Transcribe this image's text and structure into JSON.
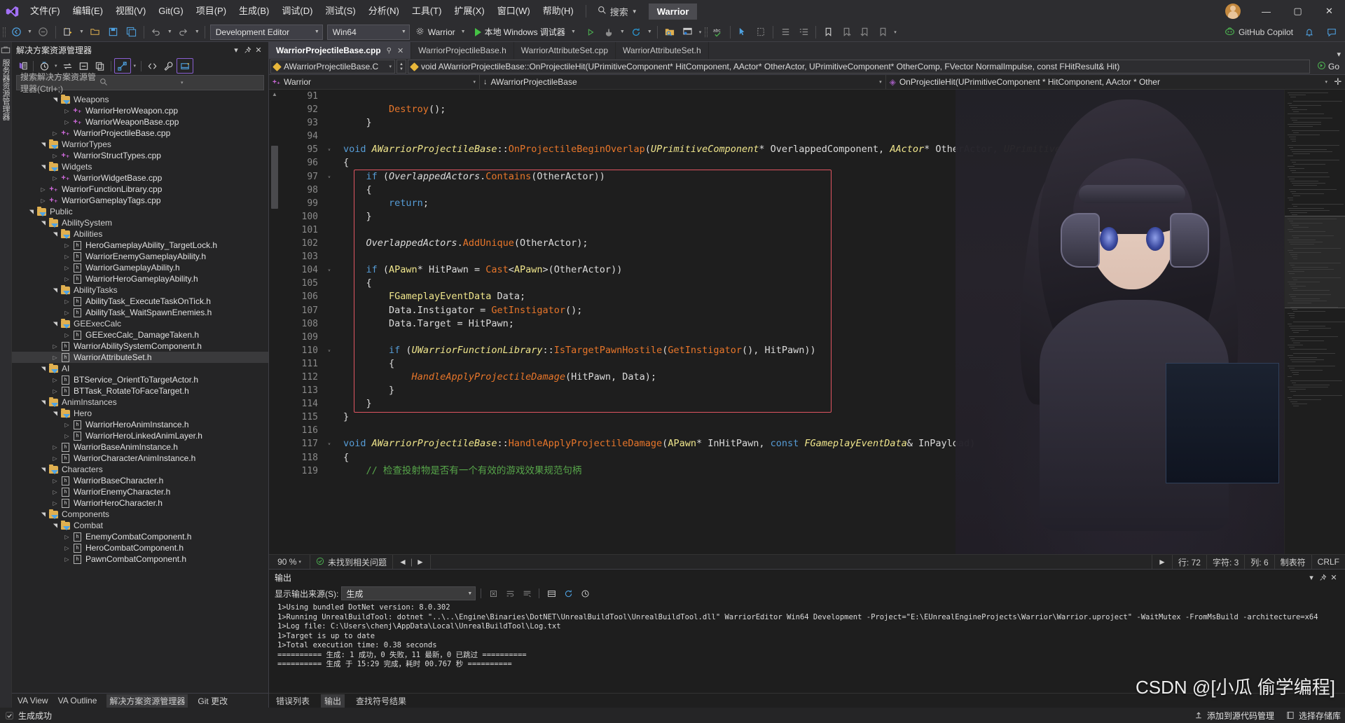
{
  "app": {
    "window_title": "Warrior",
    "logo_icon": "visual-studio-icon"
  },
  "menu": {
    "items": [
      {
        "label": "文件(F)"
      },
      {
        "label": "编辑(E)"
      },
      {
        "label": "视图(V)"
      },
      {
        "label": "Git(G)"
      },
      {
        "label": "项目(P)"
      },
      {
        "label": "生成(B)"
      },
      {
        "label": "调试(D)"
      },
      {
        "label": "测试(S)"
      },
      {
        "label": "分析(N)"
      },
      {
        "label": "工具(T)"
      },
      {
        "label": "扩展(X)"
      },
      {
        "label": "窗口(W)"
      },
      {
        "label": "帮助(H)"
      }
    ],
    "search_label": "搜索",
    "search_icon": "magnifier-icon"
  },
  "window_controls": {
    "minimize": "—",
    "maximize": "▢",
    "close": "✕",
    "avatar_icon": "user-avatar"
  },
  "toolbar": {
    "back_icon": "navigate-backward-icon",
    "forward_icon": "navigate-forward-icon",
    "new_project_icon": "new-project-icon",
    "open_icon": "open-folder-icon",
    "save_icon": "save-icon",
    "save_all_icon": "save-all-icon",
    "undo_icon": "undo-icon",
    "redo_icon": "redo-icon",
    "config_value": "Development Editor",
    "platform_value": "Win64",
    "startup_project": "Warrior",
    "startup_project_icon": "gear-icon",
    "run_label": "本地 Windows 调试器",
    "run_icon": "play-icon",
    "attach_icon": "play-hollow-icon",
    "hot_reload_icon": "hot-reload-icon",
    "refresh_icon": "refresh-icon",
    "solution_explorer_icon": "folder-search-icon",
    "window_layout_icon": "window-layout-icon",
    "spell_check_icon": "abc-check-icon",
    "pointer_icon": "pointer-icon",
    "comment_icon": "comment-icon",
    "bookmark_icon": "bookmark-icon",
    "list_icon": "list-icon",
    "copilot_label": "GitHub Copilot",
    "copilot_icon": "copilot-icon",
    "notify_icon": "bell-icon",
    "feedback_icon": "feedback-icon"
  },
  "left_rail": {
    "toolbox_icon": "toolbox-icon",
    "label": "服务器资源管理器"
  },
  "solution_explorer": {
    "title": "解决方案资源管理器",
    "dropdown_icon": "chevron-down-icon",
    "pin_icon": "pin-icon",
    "close_icon": "close-icon",
    "toolbar_icons": [
      "solution-icon",
      "pending-changes-icon",
      "sync-icon",
      "collapse-all-icon",
      "copy-icon",
      "show-all-files-icon",
      "code-view-icon",
      "properties-icon",
      "preview-icon"
    ],
    "search_placeholder": "搜索解决方案资源管理器(Ctrl+;)",
    "search_icon": "magnifier-icon",
    "tree": [
      {
        "depth": 3,
        "label": "Weapons",
        "kind": "folder",
        "state": "open"
      },
      {
        "depth": 4,
        "label": "WarriorHeroWeapon.cpp",
        "kind": "cpp",
        "state": "closed"
      },
      {
        "depth": 4,
        "label": "WarriorWeaponBase.cpp",
        "kind": "cpp",
        "state": "closed"
      },
      {
        "depth": 3,
        "label": "WarriorProjectileBase.cpp",
        "kind": "cpp",
        "state": "closed"
      },
      {
        "depth": 2,
        "label": "WarriorTypes",
        "kind": "folder",
        "state": "open"
      },
      {
        "depth": 3,
        "label": "WarriorStructTypes.cpp",
        "kind": "cpp",
        "state": "closed"
      },
      {
        "depth": 2,
        "label": "Widgets",
        "kind": "folder",
        "state": "open"
      },
      {
        "depth": 3,
        "label": "WarriorWidgetBase.cpp",
        "kind": "cpp",
        "state": "closed"
      },
      {
        "depth": 2,
        "label": "WarriorFunctionLibrary.cpp",
        "kind": "cpp",
        "state": "closed"
      },
      {
        "depth": 2,
        "label": "WarriorGameplayTags.cpp",
        "kind": "cpp",
        "state": "closed"
      },
      {
        "depth": 1,
        "label": "Public",
        "kind": "folder",
        "state": "open"
      },
      {
        "depth": 2,
        "label": "AbilitySystem",
        "kind": "folder",
        "state": "open"
      },
      {
        "depth": 3,
        "label": "Abilities",
        "kind": "folder",
        "state": "open"
      },
      {
        "depth": 4,
        "label": "HeroGameplayAbility_TargetLock.h",
        "kind": "h",
        "state": "closed"
      },
      {
        "depth": 4,
        "label": "WarriorEnemyGameplayAbility.h",
        "kind": "h",
        "state": "closed"
      },
      {
        "depth": 4,
        "label": "WarriorGameplayAbility.h",
        "kind": "h",
        "state": "closed"
      },
      {
        "depth": 4,
        "label": "WarriorHeroGameplayAbility.h",
        "kind": "h",
        "state": "closed"
      },
      {
        "depth": 3,
        "label": "AbilityTasks",
        "kind": "folder",
        "state": "open"
      },
      {
        "depth": 4,
        "label": "AbilityTask_ExecuteTaskOnTick.h",
        "kind": "h",
        "state": "closed"
      },
      {
        "depth": 4,
        "label": "AbilityTask_WaitSpawnEnemies.h",
        "kind": "h",
        "state": "closed"
      },
      {
        "depth": 3,
        "label": "GEExecCalc",
        "kind": "folder",
        "state": "open"
      },
      {
        "depth": 4,
        "label": "GEExecCalc_DamageTaken.h",
        "kind": "h",
        "state": "closed"
      },
      {
        "depth": 3,
        "label": "WarriorAbilitySystemComponent.h",
        "kind": "h",
        "state": "closed"
      },
      {
        "depth": 3,
        "label": "WarriorAttributeSet.h",
        "kind": "h",
        "state": "closed",
        "selected": true
      },
      {
        "depth": 2,
        "label": "AI",
        "kind": "folder",
        "state": "open"
      },
      {
        "depth": 3,
        "label": "BTService_OrientToTargetActor.h",
        "kind": "h",
        "state": "closed"
      },
      {
        "depth": 3,
        "label": "BTTask_RotateToFaceTarget.h",
        "kind": "h",
        "state": "closed"
      },
      {
        "depth": 2,
        "label": "AnimInstances",
        "kind": "folder",
        "state": "open"
      },
      {
        "depth": 3,
        "label": "Hero",
        "kind": "folder",
        "state": "open"
      },
      {
        "depth": 4,
        "label": "WarriorHeroAnimInstance.h",
        "kind": "h",
        "state": "closed"
      },
      {
        "depth": 4,
        "label": "WarriorHeroLinkedAnimLayer.h",
        "kind": "h",
        "state": "closed"
      },
      {
        "depth": 3,
        "label": "WarriorBaseAnimInstance.h",
        "kind": "h",
        "state": "closed"
      },
      {
        "depth": 3,
        "label": "WarriorCharacterAnimInstance.h",
        "kind": "h",
        "state": "closed"
      },
      {
        "depth": 2,
        "label": "Characters",
        "kind": "folder",
        "state": "open"
      },
      {
        "depth": 3,
        "label": "WarriorBaseCharacter.h",
        "kind": "h",
        "state": "closed"
      },
      {
        "depth": 3,
        "label": "WarriorEnemyCharacter.h",
        "kind": "h",
        "state": "closed"
      },
      {
        "depth": 3,
        "label": "WarriorHeroCharacter.h",
        "kind": "h",
        "state": "closed"
      },
      {
        "depth": 2,
        "label": "Components",
        "kind": "folder",
        "state": "open"
      },
      {
        "depth": 3,
        "label": "Combat",
        "kind": "folder",
        "state": "open"
      },
      {
        "depth": 4,
        "label": "EnemyCombatComponent.h",
        "kind": "h",
        "state": "closed"
      },
      {
        "depth": 4,
        "label": "HeroCombatComponent.h",
        "kind": "h",
        "state": "closed"
      },
      {
        "depth": 4,
        "label": "PawnCombatComponent.h",
        "kind": "h",
        "state": "closed"
      }
    ],
    "footer_tabs": [
      "VA View",
      "VA Outline",
      "解决方案资源管理器",
      "Git 更改"
    ]
  },
  "editor": {
    "tabs": [
      {
        "label": "WarriorProjectileBase.cpp",
        "active": true
      },
      {
        "label": "WarriorProjectileBase.h",
        "active": false
      },
      {
        "label": "WarriorAttributeSet.cpp",
        "active": false
      },
      {
        "label": "WarriorAttributeSet.h",
        "active": false
      }
    ],
    "tab_pin_icon": "pin-icon",
    "tab_close_icon": "close-icon",
    "nav_scope": "AWarriorProjectileBase.C",
    "nav_member": "void AWarriorProjectileBase::OnProjectileHit(UPrimitiveComponent* HitComponent, AActor* OtherActor, UPrimitiveComponent* OtherComp, FVector NormalImpulse, const FHitResult& Hit)",
    "go_label": "Go",
    "go_icon": "go-arrow-icon",
    "ctx_project": "Warrior",
    "ctx_class": "AWarriorProjectileBase",
    "ctx_function": "OnProjectileHit(UPrimitiveComponent * HitComponent, AActor * Other",
    "ctx_add_icon": "add-icon",
    "first_line": 91,
    "code_lines": [
      {
        "n": 91,
        "segs": []
      },
      {
        "n": 92,
        "segs": [
          {
            "t": "        ",
            "c": "pn"
          },
          {
            "t": "Destroy",
            "c": "fn"
          },
          {
            "t": "();",
            "c": "pn"
          }
        ]
      },
      {
        "n": 93,
        "segs": [
          {
            "t": "    }",
            "c": "pn"
          }
        ]
      },
      {
        "n": 94,
        "segs": []
      },
      {
        "n": 95,
        "fold": true,
        "segs": [
          {
            "t": "void ",
            "c": "kw"
          },
          {
            "t": "AWarriorProjectileBase",
            "c": "ty"
          },
          {
            "t": "::",
            "c": "pn"
          },
          {
            "t": "OnProjectileBeginOverlap",
            "c": "fn"
          },
          {
            "t": "(",
            "c": "pn"
          },
          {
            "t": "UPrimitiveComponent",
            "c": "ty"
          },
          {
            "t": "* OverlappedComponent, ",
            "c": "pn"
          },
          {
            "t": "AActor",
            "c": "ty"
          },
          {
            "t": "* OtherActor, ",
            "c": "pn"
          },
          {
            "t": "UPrimitiveCompor",
            "c": "ty"
          }
        ]
      },
      {
        "n": 96,
        "segs": [
          {
            "t": "{",
            "c": "pn"
          }
        ]
      },
      {
        "n": 97,
        "fold": true,
        "green": true,
        "segs": [
          {
            "t": "    ",
            "c": "pn"
          },
          {
            "t": "if ",
            "c": "kw"
          },
          {
            "t": "(",
            "c": "pn"
          },
          {
            "t": "OverlappedActors",
            "c": "vari"
          },
          {
            "t": ".",
            "c": "pn"
          },
          {
            "t": "Contains",
            "c": "fn"
          },
          {
            "t": "(OtherActor))",
            "c": "pn"
          }
        ]
      },
      {
        "n": 98,
        "green": true,
        "segs": [
          {
            "t": "    {",
            "c": "pn"
          }
        ]
      },
      {
        "n": 99,
        "green": true,
        "segs": [
          {
            "t": "        ",
            "c": "pn"
          },
          {
            "t": "return",
            "c": "kw"
          },
          {
            "t": ";",
            "c": "pn"
          }
        ]
      },
      {
        "n": 100,
        "green": true,
        "segs": [
          {
            "t": "    }",
            "c": "pn"
          }
        ]
      },
      {
        "n": 101,
        "green": true,
        "segs": []
      },
      {
        "n": 102,
        "green": true,
        "segs": [
          {
            "t": "    ",
            "c": "pn"
          },
          {
            "t": "OverlappedActors",
            "c": "vari"
          },
          {
            "t": ".",
            "c": "pn"
          },
          {
            "t": "AddUnique",
            "c": "fn"
          },
          {
            "t": "(OtherActor);",
            "c": "pn"
          }
        ]
      },
      {
        "n": 103,
        "green": true,
        "segs": []
      },
      {
        "n": 104,
        "fold": true,
        "green": true,
        "segs": [
          {
            "t": "    ",
            "c": "pn"
          },
          {
            "t": "if ",
            "c": "kw"
          },
          {
            "t": "(",
            "c": "pn"
          },
          {
            "t": "APawn",
            "c": "tyi"
          },
          {
            "t": "* HitPawn = ",
            "c": "pn"
          },
          {
            "t": "Cast",
            "c": "fn"
          },
          {
            "t": "<",
            "c": "pn"
          },
          {
            "t": "APawn",
            "c": "tyi"
          },
          {
            "t": ">(OtherActor))",
            "c": "pn"
          }
        ]
      },
      {
        "n": 105,
        "green": true,
        "segs": [
          {
            "t": "    {",
            "c": "pn"
          }
        ]
      },
      {
        "n": 106,
        "green": true,
        "segs": [
          {
            "t": "        ",
            "c": "pn"
          },
          {
            "t": "FGameplayEventData",
            "c": "tyi"
          },
          {
            "t": " Data;",
            "c": "pn"
          }
        ]
      },
      {
        "n": 107,
        "green": true,
        "segs": [
          {
            "t": "        Data.Instigator = ",
            "c": "pn"
          },
          {
            "t": "GetInstigator",
            "c": "fn"
          },
          {
            "t": "();",
            "c": "pn"
          }
        ]
      },
      {
        "n": 108,
        "green": true,
        "segs": [
          {
            "t": "        Data.Target = HitPawn;",
            "c": "pn"
          }
        ]
      },
      {
        "n": 109,
        "green": true,
        "segs": []
      },
      {
        "n": 110,
        "fold": true,
        "green": true,
        "segs": [
          {
            "t": "        ",
            "c": "pn"
          },
          {
            "t": "if ",
            "c": "kw"
          },
          {
            "t": "(",
            "c": "pn"
          },
          {
            "t": "UWarriorFunctionLibrary",
            "c": "ty"
          },
          {
            "t": "::",
            "c": "pn"
          },
          {
            "t": "IsTargetPawnHostile",
            "c": "fn"
          },
          {
            "t": "(",
            "c": "pn"
          },
          {
            "t": "GetInstigator",
            "c": "fn"
          },
          {
            "t": "(), HitPawn))",
            "c": "pn"
          }
        ]
      },
      {
        "n": 111,
        "green": true,
        "segs": [
          {
            "t": "        {",
            "c": "pn"
          }
        ]
      },
      {
        "n": 112,
        "green": true,
        "segs": [
          {
            "t": "            ",
            "c": "pn"
          },
          {
            "t": "HandleApplyProjectileDamage",
            "c": "fni"
          },
          {
            "t": "(HitPawn, Data);",
            "c": "pn"
          }
        ]
      },
      {
        "n": 113,
        "green": true,
        "segs": [
          {
            "t": "        }",
            "c": "pn"
          }
        ]
      },
      {
        "n": 114,
        "green": true,
        "segs": [
          {
            "t": "    }",
            "c": "pn"
          }
        ]
      },
      {
        "n": 115,
        "segs": [
          {
            "t": "}",
            "c": "pn"
          }
        ]
      },
      {
        "n": 116,
        "segs": []
      },
      {
        "n": 117,
        "fold": true,
        "segs": [
          {
            "t": "void ",
            "c": "kw"
          },
          {
            "t": "AWarriorProjectileBase",
            "c": "ty"
          },
          {
            "t": "::",
            "c": "pn"
          },
          {
            "t": "HandleApplyProjectileDamage",
            "c": "fn"
          },
          {
            "t": "(",
            "c": "pn"
          },
          {
            "t": "APawn",
            "c": "tyi"
          },
          {
            "t": "* InHitPawn, ",
            "c": "pn"
          },
          {
            "t": "const ",
            "c": "kw"
          },
          {
            "t": "FGameplayEventData",
            "c": "ty"
          },
          {
            "t": "& InPayload)",
            "c": "pn"
          }
        ]
      },
      {
        "n": 118,
        "segs": [
          {
            "t": "{",
            "c": "pn"
          }
        ]
      },
      {
        "n": 119,
        "segs": [
          {
            "t": "    ",
            "c": "pn"
          },
          {
            "t": "// 检查投射物是否有一个有效的游戏效果规范句柄",
            "c": "cmt"
          }
        ]
      }
    ],
    "status": {
      "zoom": "90 %",
      "issues_text": "未找到相关问题",
      "issues_icon": "checkmark-circle-icon",
      "prev_icon": "chevron-left-icon",
      "next_icon": "chevron-right-icon",
      "line_label": "行: 72",
      "char_label": "字符: 3",
      "col_label": "列: 6",
      "tabs_label": "制表符",
      "eol_label": "CRLF"
    }
  },
  "output": {
    "title": "输出",
    "dropdown_icon": "chevron-down-icon",
    "pin_icon": "pin-icon",
    "close_icon": "close-icon",
    "source_label": "显示输出来源(S):",
    "source_value": "生成",
    "tool_icons": [
      "clear-all-icon",
      "toggle-wordwrap-icon",
      "toggle-autoscroll-icon",
      "list-icon",
      "sync-icon",
      "clock-icon"
    ],
    "lines": [
      "1>Using bundled DotNet version: 8.0.302",
      "1>Running UnrealBuildTool: dotnet \"..\\..\\Engine\\Binaries\\DotNET\\UnrealBuildTool\\UnrealBuildTool.dll\" WarriorEditor Win64 Development -Project=\"E:\\EUnrealEngineProjects\\Warrior\\Warrior.uproject\" -WaitMutex -FromMsBuild -architecture=x64",
      "1>Log file: C:\\Users\\chenj\\AppData\\Local\\UnrealBuildTool\\Log.txt",
      "1>Target is up to date",
      "1>Total execution time: 0.38 seconds",
      "========== 生成: 1 成功，0 失败，11 最新，0 已跳过 ==========",
      "========== 生成 于 15:29 完成，耗时 00.767 秒 =========="
    ],
    "bottom_tabs": [
      "错误列表",
      "输出",
      "查找符号结果"
    ]
  },
  "statusbar": {
    "ready_text": "生成成功",
    "ready_icon": "check-icon",
    "source_control_text": "添加到源代码管理",
    "source_control_icon": "upload-icon",
    "select_repo_text": "选择存储库",
    "select_repo_icon": "repo-icon"
  },
  "watermark": "CSDN @[小瓜 偷学编程]",
  "colors": {
    "accent": "#0078d4",
    "toolbar_bg": "#2d2d30",
    "panel_bg": "#252526",
    "editor_bg": "#1e1e1e",
    "selection": "#3a3a3c",
    "error_box": "#e05561",
    "change_bar": "#4ec94e"
  }
}
